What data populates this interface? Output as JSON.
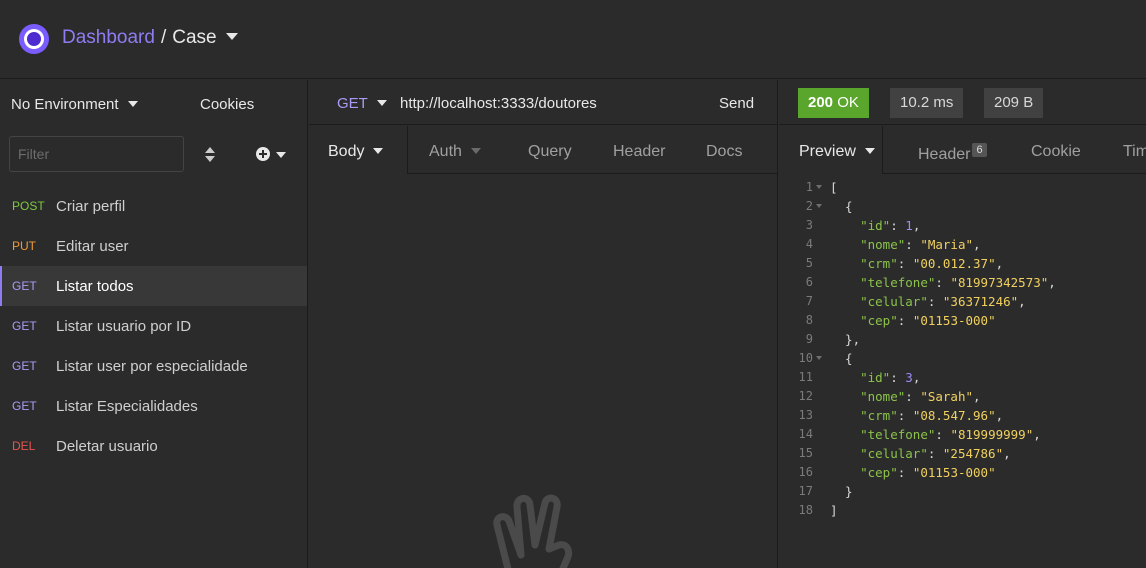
{
  "header": {
    "dashboard": "Dashboard",
    "separator": "/",
    "workspace": "Case"
  },
  "sidebar": {
    "environment": "No Environment",
    "cookies": "Cookies",
    "filter_placeholder": "Filter",
    "requests": [
      {
        "method": "POST",
        "name": "Criar perfil"
      },
      {
        "method": "PUT",
        "name": "Editar user"
      },
      {
        "method": "GET",
        "name": "Listar todos"
      },
      {
        "method": "GET",
        "name": "Listar usuario por ID"
      },
      {
        "method": "GET",
        "name": "Listar user por especialidade"
      },
      {
        "method": "GET",
        "name": "Listar Especialidades"
      },
      {
        "method": "DEL",
        "name": "Deletar usuario"
      }
    ]
  },
  "request": {
    "method": "GET",
    "url": "http://localhost:3333/doutores",
    "send": "Send",
    "tabs": [
      "Body",
      "Auth",
      "Query",
      "Header",
      "Docs"
    ]
  },
  "response": {
    "status_code": "200",
    "status_text": "OK",
    "time": "10.2 ms",
    "size": "209 B",
    "tabs": [
      "Preview",
      "Header",
      "Cookie",
      "Timeline"
    ],
    "header_count": "6",
    "line_numbers": [
      "1",
      "2",
      "3",
      "4",
      "5",
      "6",
      "7",
      "8",
      "9",
      "10",
      "11",
      "12",
      "13",
      "14",
      "15",
      "16",
      "17",
      "18"
    ],
    "doctors": [
      {
        "id": "1",
        "nome": "\"Maria\"",
        "crm": "\"00.012.37\"",
        "telefone": "\"81997342573\"",
        "celular": "\"36371246\"",
        "cep": "\"01153-000\""
      },
      {
        "id": "3",
        "nome": "\"Sarah\"",
        "crm": "\"08.547.96\"",
        "telefone": "\"819999999\"",
        "celular": "\"254786\"",
        "cep": "\"01153-000\""
      }
    ],
    "keys": {
      "id": "\"id\"",
      "nome": "\"nome\"",
      "crm": "\"crm\"",
      "telefone": "\"telefone\"",
      "celular": "\"celular\"",
      "cep": "\"cep\""
    }
  },
  "colors": {
    "accent": "#8f7cf2",
    "ok": "#5aa52c",
    "post": "#7ec93f",
    "put": "#f19a38",
    "get": "#a99cf6",
    "del": "#e5554d"
  },
  "icons": {
    "logo": "insomnia-logo-icon",
    "sort": "sort-icon",
    "add": "add-circle-icon",
    "empty": "peace-hand-icon"
  }
}
